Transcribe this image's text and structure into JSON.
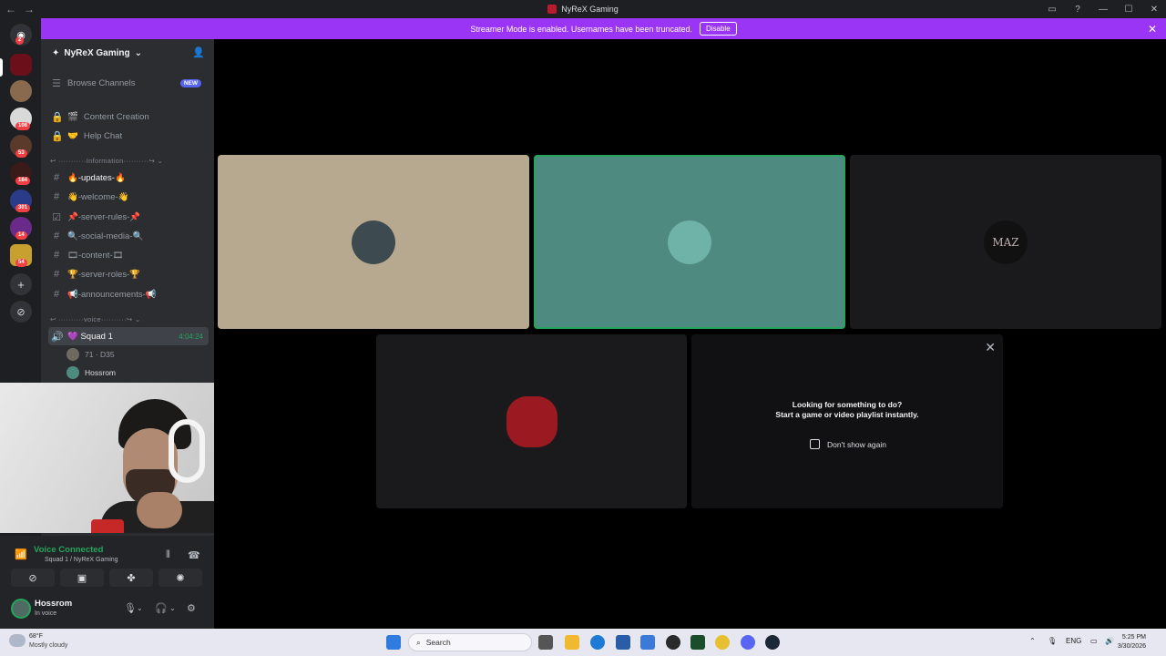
{
  "window": {
    "title": "NyReX Gaming"
  },
  "banner": {
    "text": "Streamer Mode is enabled. Usernames have been truncated.",
    "disable_label": "Disable"
  },
  "guilds": {
    "badges": [
      "2",
      "108",
      "53",
      "184",
      "301",
      "14",
      "54"
    ]
  },
  "server": {
    "name": "NyReX Gaming",
    "browse_label": "Browse Channels",
    "new_badge": "NEW",
    "locked_channels": [
      {
        "emoji": "🎬",
        "name": "Content Creation"
      },
      {
        "emoji": "🤝",
        "name": "Help Chat"
      }
    ],
    "category_information": "↩ ···········Information··········↪ ⌄",
    "text_channels": [
      {
        "icon": "#",
        "name": "🔥-updates-🔥"
      },
      {
        "icon": "#",
        "name": "👋-welcome-👋"
      },
      {
        "icon": "☑",
        "name": "📌-server-rules-📌"
      },
      {
        "icon": "#",
        "name": "🔍-social-media-🔍"
      },
      {
        "icon": "#",
        "name": "🎞-content-🎞"
      },
      {
        "icon": "#",
        "name": "🏆-server-roles-🏆"
      },
      {
        "icon": "#",
        "name": "📢-announcements-📢"
      }
    ],
    "category_voice": "↩ ··········voice··········↪ ⌄",
    "voice_channel": {
      "name": "💜 Squad 1",
      "timer": "4:04:24"
    },
    "voice_users": [
      {
        "name": "71 · D35"
      },
      {
        "name": "Hossrom"
      }
    ]
  },
  "voice_panel": {
    "status": "Voice Connected",
    "channel": "Squad 1 / NyReX Gaming"
  },
  "user": {
    "name": "Hossrom",
    "status": "In voice"
  },
  "stage": {
    "activity": {
      "line1": "Looking for something to do?",
      "line2": "Start a game or video playlist instantly.",
      "dont_show": "Don't show again"
    },
    "tile3_logo": "MAZ"
  },
  "taskbar": {
    "temp": "68°F",
    "weather": "Mostly cloudy",
    "search": "Search",
    "lang": "ENG",
    "time": "5:25 PM",
    "date": "3/30/2026"
  },
  "colors": {
    "banner": "#9b35f5",
    "voice_green": "#23a55a",
    "tile1": "#b7a990",
    "tile2": "#4f8a80"
  }
}
